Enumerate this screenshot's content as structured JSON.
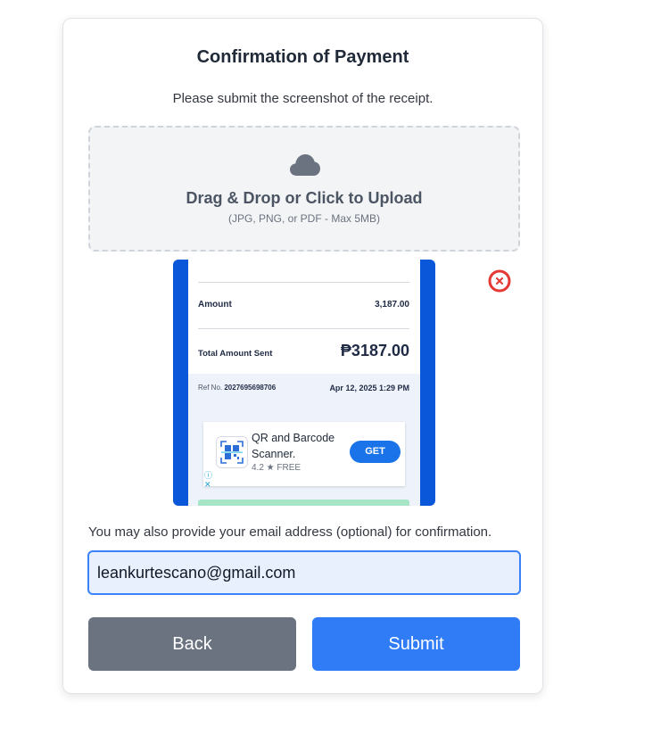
{
  "card": {
    "title": "Confirmation of Payment",
    "subtitle": "Please submit the screenshot of the receipt."
  },
  "dropzone": {
    "icon": "cloud-upload-icon",
    "title": "Drag & Drop or Click to Upload",
    "hint": "(JPG, PNG, or PDF - Max 5MB)"
  },
  "preview": {
    "receipt": {
      "amount_label": "Amount",
      "amount_value": "3,187.00",
      "total_label": "Total Amount Sent",
      "total_value": "₱3187.00",
      "ref_prefix": "Ref No.",
      "ref_number": "2027695698706",
      "date": "Apr 12, 2025 1:29 PM"
    },
    "ad": {
      "title": "QR and Barcode Scanner.",
      "rating": "4.2 ★ FREE",
      "get_label": "GET",
      "info_icon": "ⓘ",
      "close_icon": "✕"
    },
    "remove_icon": "close-circle-icon"
  },
  "email": {
    "label": "You may also provide your email address (optional) for confirmation.",
    "value": "leankurtescano@gmail.com"
  },
  "buttons": {
    "back": "Back",
    "submit": "Submit"
  },
  "colors": {
    "primary": "#2f7cf6",
    "secondary": "#6b7280",
    "danger": "#e53935"
  }
}
